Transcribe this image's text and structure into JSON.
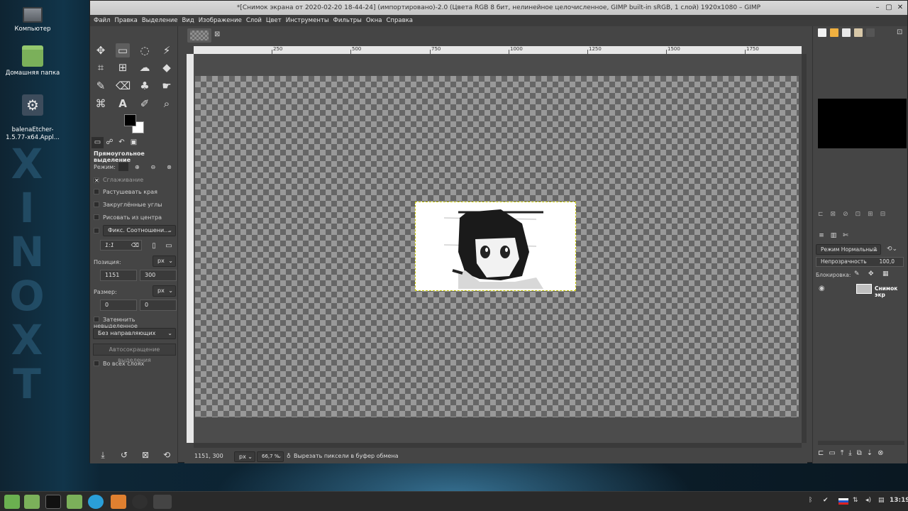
{
  "desktop": {
    "icons": [
      {
        "name": "computer",
        "label": "Компьютер"
      },
      {
        "name": "home-folder",
        "label": "Домашняя папка"
      },
      {
        "name": "balena",
        "label": "balenaEtcher-\n1.5.77-x64.Appl..."
      }
    ]
  },
  "window": {
    "title": "*[Снимок экрана от 2020-02-20 18-44-24] (импортировано)-2.0 (Цвета RGB 8 бит, нелинейное целочисленное, GIMP built-in sRGB, 1 слой) 1920x1080 – GIMP"
  },
  "menu": [
    "Файл",
    "Правка",
    "Выделение",
    "Вид",
    "Изображение",
    "Слой",
    "Цвет",
    "Инструменты",
    "Фильтры",
    "Окна",
    "Справка"
  ],
  "tool_options": {
    "title": "Прямоугольное выделение",
    "mode_label": "Режим:",
    "antialias": "Сглаживание",
    "feather": "Растушевать края",
    "rounded": "Закруглённые углы",
    "from_center": "Рисовать из центра",
    "fixed": "Фикс. Соотношени...",
    "ratio": "1:1",
    "position_label": "Позиция:",
    "pos_unit": "px",
    "pos_x": "1151",
    "pos_y": "300",
    "size_label": "Размер:",
    "size_unit": "px",
    "size_w": "0",
    "size_h": "0",
    "highlight": "Затемнить невыделенное",
    "guides": "Без направляющих",
    "autoshrink": "Автосокращение выделения",
    "all_layers": "Во всех слоях"
  },
  "ruler": {
    "labels": [
      "250",
      "500",
      "750",
      "1000",
      "1250",
      "1500",
      "1750"
    ]
  },
  "status": {
    "coords": "1151, 300",
    "unit": "px",
    "zoom": "66,7 %",
    "message": "Вырезать пиксели в буфер обмена"
  },
  "layers": {
    "mode": "Режим Нормальный",
    "opacity_label": "Непрозрачность",
    "opacity": "100,0",
    "lock_label": "Блокировка:",
    "layer_name": "Снимок экр"
  },
  "taskbar": {
    "clock": "13:19"
  }
}
